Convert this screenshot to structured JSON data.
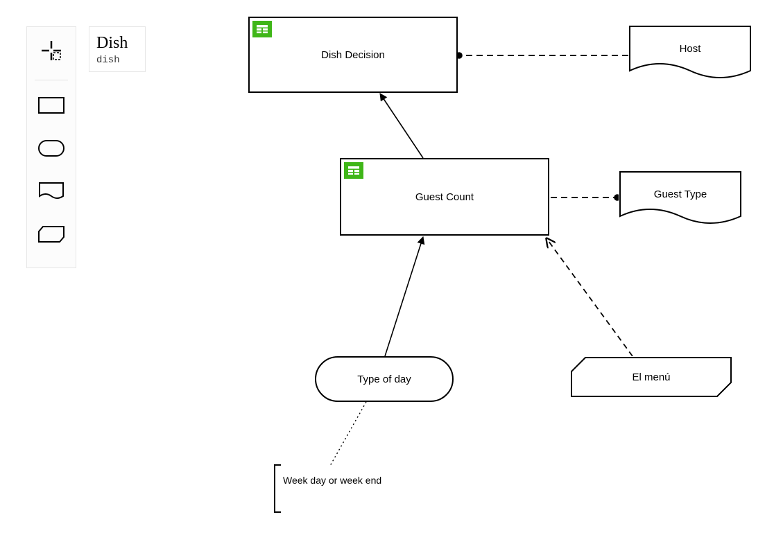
{
  "info": {
    "title": "Dish",
    "type": "dish"
  },
  "tools": {
    "lasso": "lasso-select-icon",
    "rect": "decision-shape-icon",
    "rounded": "input-shape-icon",
    "bkm": "business-knowledge-shape-icon",
    "knowledge": "knowledge-source-shape-icon"
  },
  "nodes": {
    "dishDecision": {
      "label": "Dish Decision"
    },
    "guestCount": {
      "label": "Guest Count"
    },
    "host": {
      "label": "Host"
    },
    "guestType": {
      "label": "Guest Type"
    },
    "typeOfDay": {
      "label": "Type of day"
    },
    "menu": {
      "label": "El menú"
    }
  },
  "annotation": {
    "text": "Week day or week end"
  }
}
